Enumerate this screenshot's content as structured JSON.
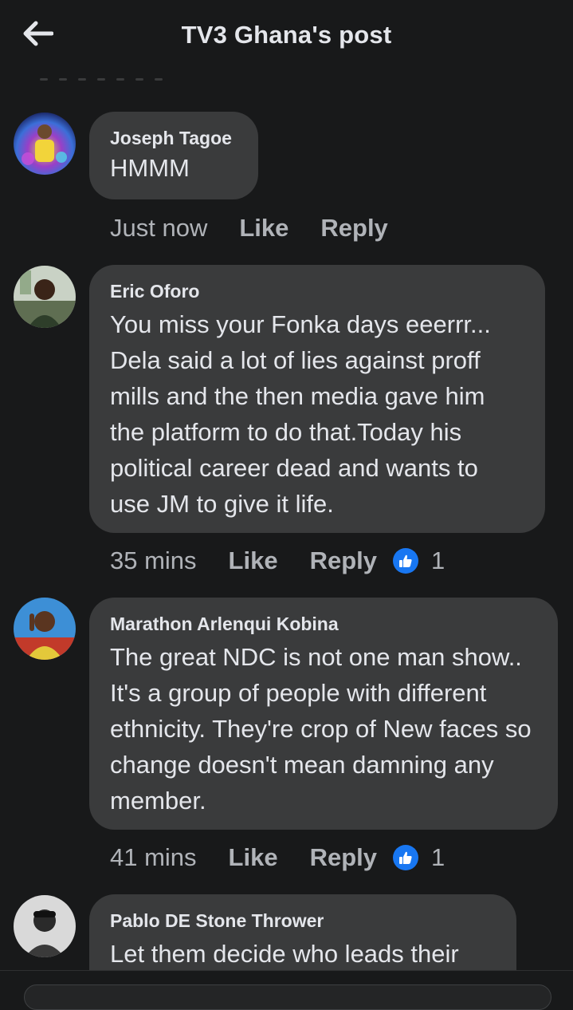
{
  "header": {
    "title": "TV3 Ghana's post",
    "back_icon": "arrow-left-icon"
  },
  "comments": [
    {
      "author": "Joseph Tagoe",
      "text": "HMMM",
      "time": "Just now",
      "like_label": "Like",
      "reply_label": "Reply",
      "reaction_count": ""
    },
    {
      "author": "Eric Oforo",
      "text": "You miss your Fonka days eeerrr... Dela said a lot of lies against proff mills and the then media gave him the platform to do that.Today his political career dead and wants to use JM to give it life.",
      "time": "35 mins",
      "like_label": "Like",
      "reply_label": "Reply",
      "reaction_count": "1"
    },
    {
      "author": "Marathon Arlenqui Kobina",
      "text": "The great NDC is not one man show.. It's a group of people with different ethnicity. They're crop of New faces so change doesn't mean damning any member.",
      "time": "41 mins",
      "like_label": "Like",
      "reply_label": "Reply",
      "reaction_count": "1"
    },
    {
      "author": "Pablo DE Stone Thrower",
      "text": "Let them decide who leads their"
    }
  ],
  "colors": {
    "background": "#18191a",
    "bubble": "#3a3b3c",
    "text": "#e4e6eb",
    "meta": "#b0b3b8",
    "like_blue": "#1877f2"
  }
}
